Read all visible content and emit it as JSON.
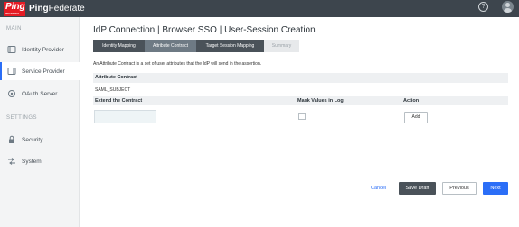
{
  "topbar": {
    "logo_text": "Ping",
    "logo_subtext": "IDENTITY",
    "brand_prefix": "Ping",
    "brand_suffix": "Federate",
    "help_label": "?"
  },
  "sidebar": {
    "main_label": "MAIN",
    "settings_label": "SETTINGS",
    "items": [
      {
        "label": "Identity Provider",
        "icon": "identity-provider-icon"
      },
      {
        "label": "Service Provider",
        "icon": "service-provider-icon"
      },
      {
        "label": "OAuth Server",
        "icon": "oauth-server-icon"
      },
      {
        "label": "Security",
        "icon": "security-icon"
      },
      {
        "label": "System",
        "icon": "system-icon"
      }
    ]
  },
  "page": {
    "title": "IdP Connection | Browser SSO | User-Session Creation",
    "tabs": [
      {
        "label": "Identity Mapping"
      },
      {
        "label": "Attribute Contract"
      },
      {
        "label": "Target Session Mapping"
      },
      {
        "label": "Summary"
      }
    ],
    "description": "An Attribute Contract is a set of user attributes that the IdP will send in the assertion.",
    "contract_header": "Attribute Contract",
    "subject": "SAML_SUBJECT",
    "columns": {
      "extend": "Extend the Contract",
      "mask": "Mask Values in Log",
      "action": "Action"
    },
    "add_label": "Add"
  },
  "footer": {
    "cancel": "Cancel",
    "save_draft": "Save Draft",
    "previous": "Previous",
    "next": "Next"
  },
  "colors": {
    "topbar": "#3d454d",
    "accent": "#2b6ef7",
    "brand_red": "#e51b24"
  }
}
